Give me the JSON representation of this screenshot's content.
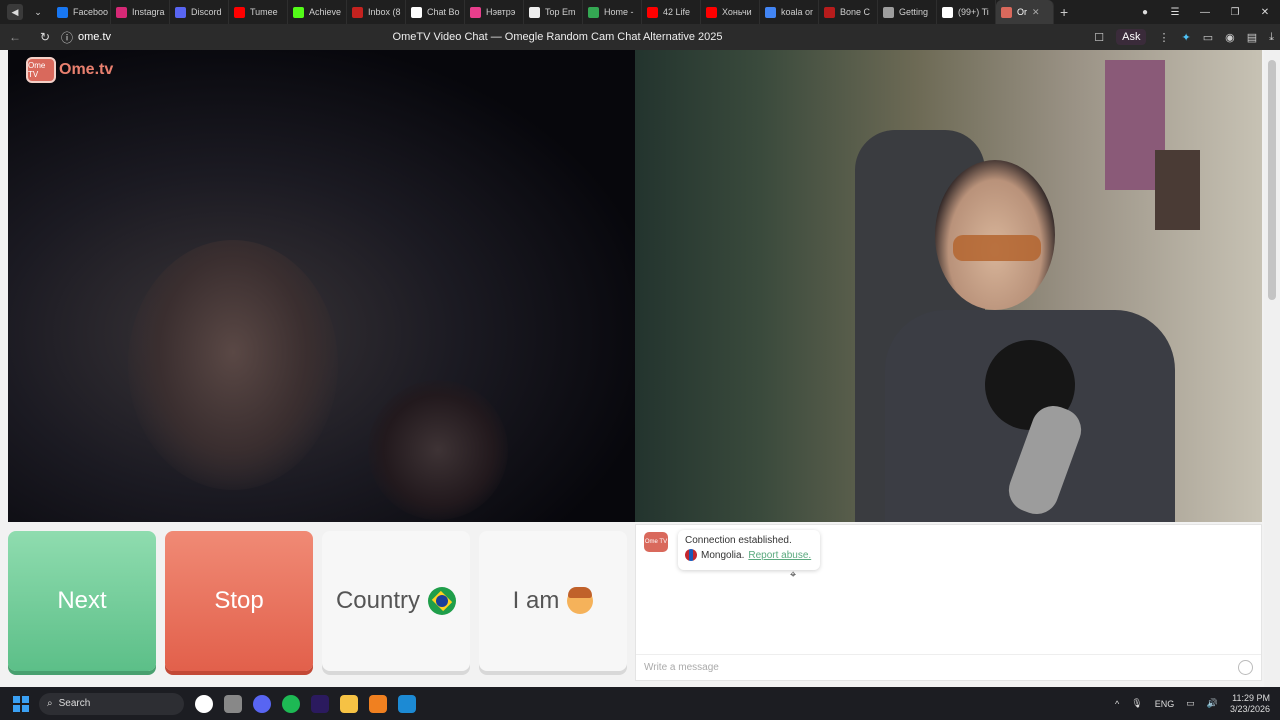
{
  "browser": {
    "tabs": [
      {
        "label": "Faceboo",
        "color": "#1877f2"
      },
      {
        "label": "Instagra",
        "color": "#d62976"
      },
      {
        "label": "Discord",
        "color": "#5865f2"
      },
      {
        "label": "Tumee",
        "color": "#ff0000"
      },
      {
        "label": "Achieve",
        "color": "#53fc18"
      },
      {
        "label": "Inbox (8",
        "color": "#c5221f"
      },
      {
        "label": "Chat Bo",
        "color": "#ffffff"
      },
      {
        "label": "Нэвтрэ",
        "color": "#e83e8c"
      },
      {
        "label": "Top Em",
        "color": "#eeeeee"
      },
      {
        "label": "Home -",
        "color": "#34a853"
      },
      {
        "label": "42 Life",
        "color": "#ff0000"
      },
      {
        "label": "Хоньчи",
        "color": "#ff0000"
      },
      {
        "label": "koala or",
        "color": "#4285f4"
      },
      {
        "label": "Bone C",
        "color": "#b71c1c"
      },
      {
        "label": "Getting",
        "color": "#9e9e9e"
      },
      {
        "label": "(99+) Ti",
        "color": "#ffffff"
      },
      {
        "label": "Or",
        "color": "#d9695c",
        "active": true
      }
    ],
    "new_tab": "+",
    "url": "ome.tv",
    "page_title": "OmeTV Video Chat — Omegle Random Cam Chat Alternative 2025",
    "ask_label": "Ask"
  },
  "site": {
    "logo_box": "Ome TV",
    "logo_text": "Ome.tv"
  },
  "controls": {
    "next": "Next",
    "stop": "Stop",
    "country": "Country",
    "iam": "I am"
  },
  "chat": {
    "avatar": "Ome TV",
    "status": "Connection established.",
    "country": "Mongolia.",
    "report": "Report abuse.",
    "placeholder": "Write a message"
  },
  "taskbar": {
    "search": "Search",
    "lang": "ENG",
    "time": "11:29 PM",
    "date": "3/23/2026",
    "apps": [
      "#ffffff",
      "#888888",
      "#5865f2",
      "#1db954",
      "#2b1a5e",
      "#f6c244",
      "#f08020",
      "#1c8ad4"
    ]
  }
}
